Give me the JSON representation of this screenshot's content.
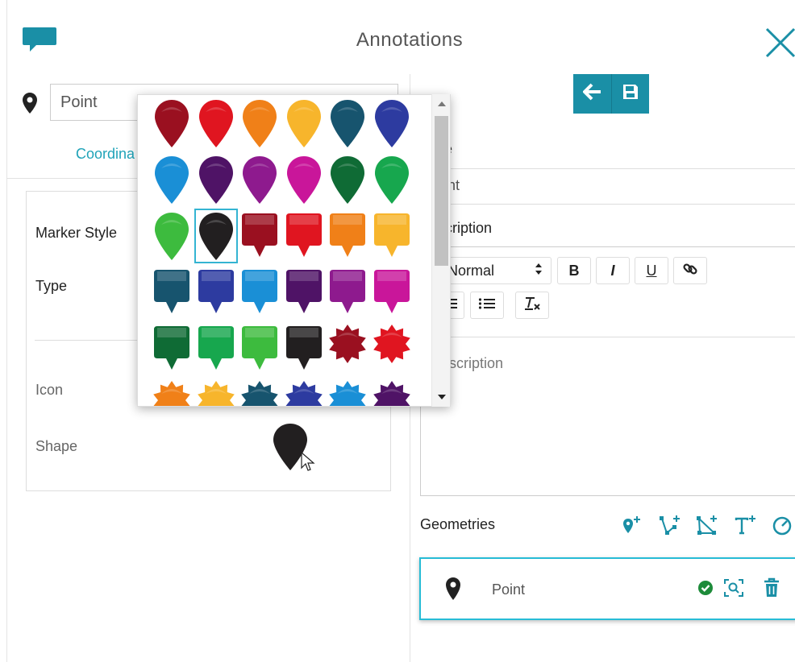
{
  "header": {
    "title": "Annotations",
    "chat_icon": "speech-bubble-icon",
    "close_icon": "close-x-icon"
  },
  "left": {
    "name_value": "Point",
    "tab_coordinates": "Coordina",
    "marker_style_label": "Marker Style",
    "type_label": "Type",
    "icon_label": "Icon",
    "shape_label": "Shape"
  },
  "right": {
    "name_label_partial": "e",
    "name_value_partial": "int",
    "description_label_partial": "cription",
    "heading_select": "Normal",
    "bold": "B",
    "italic": "I",
    "underline": "U",
    "description_placeholder_partial": "escription",
    "geometries_label": "Geometries",
    "geometry_item_label": "Point"
  },
  "colors": {
    "accent": "#1a8fa6",
    "tab_link": "#1fa3b8",
    "selected_outline": "#34b4d2",
    "geo_border": "#27bcd6",
    "status_ok": "#1d8b3a"
  },
  "marker_palette": [
    [
      "#9a1020",
      "#e01520",
      "#f08018",
      "#f7b52c",
      "#17546e",
      "#2d3ba0"
    ],
    [
      "#1a8fd6",
      "#4f1366",
      "#8e1a8e",
      "#c9169a",
      "#0f6b35",
      "#17a74e"
    ],
    [
      "#3dbb3e",
      "#221f20",
      "#9a1020",
      "#e01520",
      "#f08018",
      "#f7b52c"
    ],
    [
      "#17546e",
      "#2d3ba0",
      "#1a8fd6",
      "#4f1366",
      "#8e1a8e",
      "#c9169a"
    ],
    [
      "#0f6b35",
      "#17a74e",
      "#3dbb3e",
      "#221f20",
      "#9a1020",
      "#e01520"
    ],
    [
      "#f08018",
      "#f7b52c",
      "#17546e",
      "#2d3ba0",
      "#1a8fd6",
      "#4f1366"
    ]
  ],
  "marker_shapes": [
    "pin",
    "pin",
    "square-pin",
    "square-pin",
    "star",
    "star"
  ],
  "selected_marker": {
    "row": 2,
    "col": 1
  }
}
